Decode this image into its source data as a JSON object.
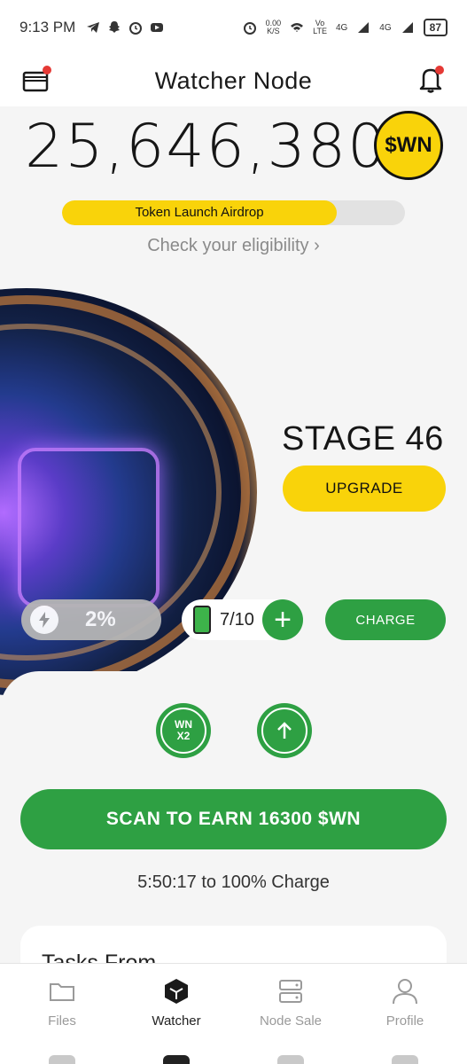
{
  "status_bar": {
    "time": "9:13 PM",
    "speed_value": "0.00",
    "speed_unit": "K/S",
    "volte_top": "Vo",
    "volte_bottom": "LTE",
    "net1": "4G",
    "net2": "4G",
    "battery": "87"
  },
  "app_bar": {
    "title": "Watcher Node"
  },
  "balance": {
    "amount": "25,646,380",
    "token_symbol": "$WN"
  },
  "airdrop": {
    "label": "Token Launch Airdrop",
    "progress": 0.8,
    "eligibility_link": "Check your eligibility ›"
  },
  "stage": {
    "label": "STAGE 46",
    "upgrade_button": "UPGRADE"
  },
  "energy": {
    "percent": "2%",
    "battery_count": "7/10",
    "plus": "+",
    "charge_button": "CHARGE"
  },
  "boosts": {
    "x2_line1": "WN",
    "x2_line2": "X2"
  },
  "scan_button": "SCAN TO EARN 16300 $WN",
  "timer_text": "5:50:17 to 100% Charge",
  "tasks": {
    "title": "Tasks From"
  },
  "nav": {
    "items": [
      {
        "label": "Files",
        "icon": "folder-icon"
      },
      {
        "label": "Watcher",
        "icon": "cube-icon"
      },
      {
        "label": "Node Sale",
        "icon": "server-icon"
      },
      {
        "label": "Profile",
        "icon": "user-icon"
      }
    ],
    "active": "Watcher"
  },
  "colors": {
    "accent_yellow": "#f9d30a",
    "accent_green": "#2ea043",
    "notification_red": "#e53935"
  }
}
